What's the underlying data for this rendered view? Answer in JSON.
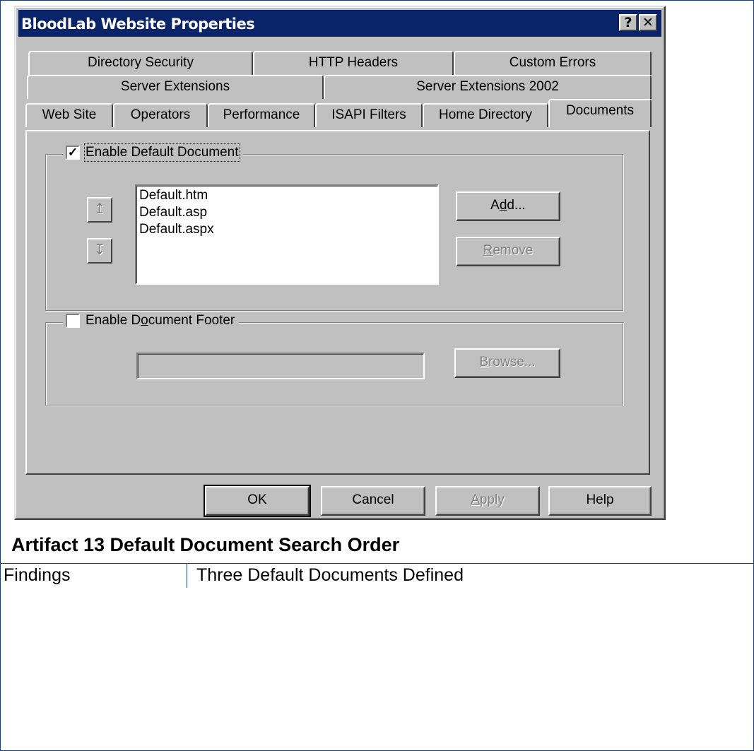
{
  "window": {
    "title": "BloodLab Website Properties",
    "help_glyph": "?",
    "close_glyph": "✕"
  },
  "tabs": {
    "row1": [
      "Directory Security",
      "HTTP Headers",
      "Custom Errors"
    ],
    "row2": [
      "Server Extensions",
      "Server Extensions 2002"
    ],
    "row3": [
      "Web Site",
      "Operators",
      "Performance",
      "ISAPI Filters",
      "Home Directory",
      "Documents"
    ],
    "active": "Documents"
  },
  "default_document": {
    "enable_label": "Enable Default Document",
    "checked": true,
    "documents": [
      "Default.htm",
      "Default.asp",
      "Default.aspx"
    ],
    "move_up_glyph": "↥",
    "move_down_glyph": "↧",
    "add_label": "Add...",
    "remove_label": "Remove"
  },
  "document_footer": {
    "enable_label": "Enable Document Footer",
    "checked": false,
    "path_value": "",
    "browse_label": "Browse..."
  },
  "footer_buttons": {
    "ok": "OK",
    "cancel": "Cancel",
    "apply": "Apply",
    "help": "Help"
  },
  "caption": "Artifact 13 Default Document Search Order",
  "findings": {
    "label": "Findings",
    "value": "Three Default Documents Defined"
  },
  "colors": {
    "titlebar": "#0a246a",
    "dialog_face": "#c0c0c0",
    "frame_border": "#1a3a7a"
  }
}
